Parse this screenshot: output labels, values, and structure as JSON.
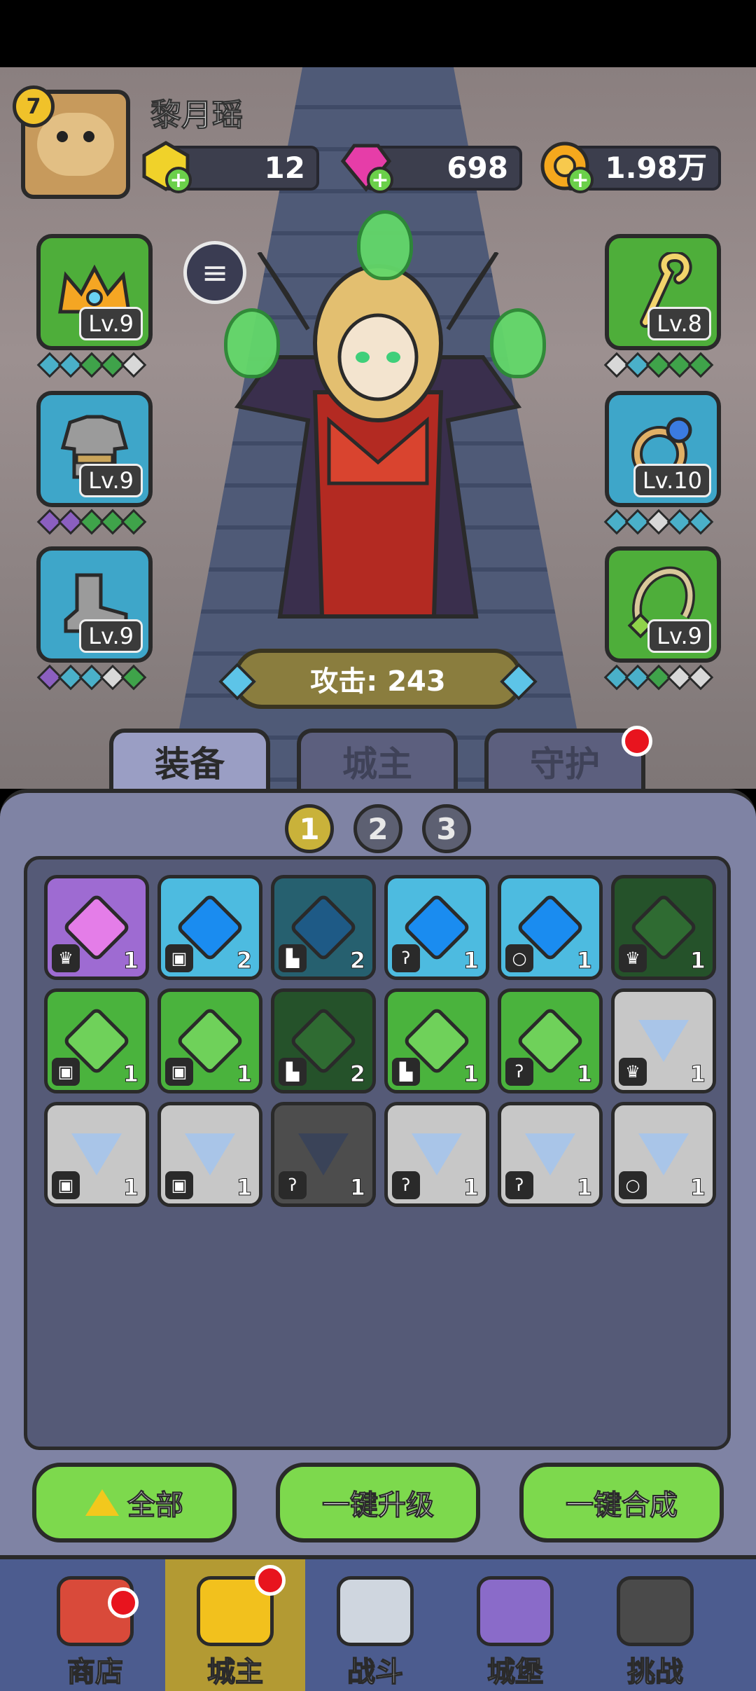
{
  "player": {
    "name": "黎月瑶",
    "level": "7",
    "currencies": [
      {
        "name": "yellow-gem",
        "value": "12",
        "color": "#f0d22a"
      },
      {
        "name": "pink-gem",
        "value": "698",
        "color": "#e63da8"
      },
      {
        "name": "gold-coin",
        "value": "1.98万",
        "color": "#f5a81d"
      }
    ]
  },
  "equipment": {
    "left": [
      {
        "name": "crown",
        "level": "Lv.9",
        "icon": "crown-icon"
      },
      {
        "name": "armor",
        "level": "Lv.9",
        "icon": "armor-icon"
      },
      {
        "name": "boots",
        "level": "Lv.9",
        "icon": "boot-icon"
      }
    ],
    "right": [
      {
        "name": "staff",
        "level": "Lv.8",
        "icon": "staff-icon"
      },
      {
        "name": "ring",
        "level": "Lv.10",
        "icon": "ring-icon"
      },
      {
        "name": "necklace",
        "level": "Lv.9",
        "icon": "necklace-icon"
      }
    ]
  },
  "hero": {
    "attack_label": "攻击: 243"
  },
  "tabs": [
    {
      "label": "装备",
      "active": true
    },
    {
      "label": "城主",
      "active": false
    },
    {
      "label": "守护",
      "active": false,
      "notification": true
    }
  ],
  "pages": [
    "1",
    "2",
    "3"
  ],
  "inventory": [
    [
      {
        "color": "purple",
        "type": "crown",
        "count": "1"
      },
      {
        "color": "blue",
        "type": "armor",
        "count": "2"
      },
      {
        "color": "blue-dim",
        "type": "boot",
        "count": "2"
      },
      {
        "color": "blue",
        "type": "staff",
        "count": "1"
      },
      {
        "color": "blue",
        "type": "ring",
        "count": "1"
      },
      {
        "color": "green-dim",
        "type": "crown",
        "count": "1"
      }
    ],
    [
      {
        "color": "green",
        "type": "armor",
        "count": "1"
      },
      {
        "color": "green",
        "type": "armor",
        "count": "1"
      },
      {
        "color": "green-dim",
        "type": "boot",
        "count": "2"
      },
      {
        "color": "green",
        "type": "boot",
        "count": "1"
      },
      {
        "color": "green",
        "type": "staff",
        "count": "1"
      },
      {
        "color": "gray",
        "type": "crown",
        "count": "1"
      }
    ],
    [
      {
        "color": "gray",
        "type": "armor",
        "count": "1"
      },
      {
        "color": "gray",
        "type": "armor",
        "count": "1"
      },
      {
        "color": "gray-dim",
        "type": "staff",
        "count": "1"
      },
      {
        "color": "gray",
        "type": "staff",
        "count": "1"
      },
      {
        "color": "gray",
        "type": "staff",
        "count": "1"
      },
      {
        "color": "gray",
        "type": "ring",
        "count": "1"
      }
    ]
  ],
  "actions": {
    "all": "全部",
    "upgrade": "一键升级",
    "merge": "一键合成"
  },
  "nav": [
    {
      "label": "商店",
      "notification": true
    },
    {
      "label": "城主",
      "active": true,
      "notification": true
    },
    {
      "label": "战斗"
    },
    {
      "label": "城堡"
    },
    {
      "label": "挑战"
    }
  ]
}
